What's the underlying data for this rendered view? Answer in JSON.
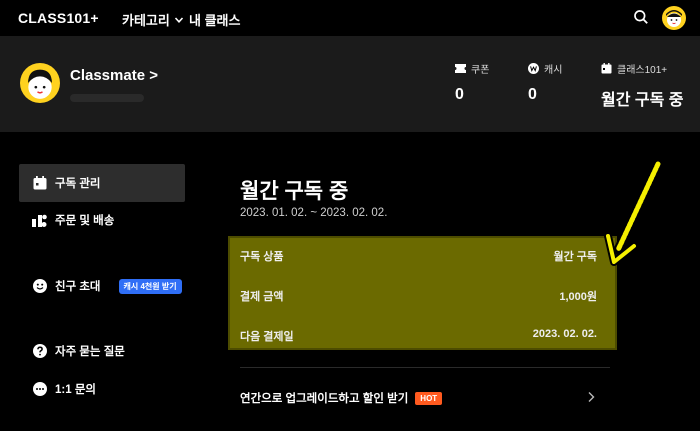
{
  "nav": {
    "logo": "CLASS101+",
    "category_label": "카테고리",
    "my_classes_label": "내 클래스"
  },
  "profile": {
    "name": "Classmate",
    "name_chevron": ">"
  },
  "stats": {
    "coupon_label": "쿠폰",
    "coupon_value": "0",
    "cash_label": "캐시",
    "cash_value": "0",
    "class_label": "클래스101+",
    "class_value": "월간 구독 중"
  },
  "sidebar": {
    "items": [
      {
        "label": "구독 관리"
      },
      {
        "label": "주문 및 배송"
      },
      {
        "label": "친구 초대",
        "badge": "캐시 4천원 받기"
      },
      {
        "label": "자주 묻는 질문"
      },
      {
        "label": "1:1 문의"
      }
    ]
  },
  "main": {
    "title": "월간 구독 중",
    "period": "2023. 01. 02. ~ 2023. 02. 02.",
    "details": [
      {
        "label": "구독 상품",
        "value": "월간 구독"
      },
      {
        "label": "결제 금액",
        "value": "1,000원"
      },
      {
        "label": "다음 결제일",
        "value": "2023. 02. 02."
      }
    ],
    "upgrade_label": "연간으로 업그레이드하고 할인 받기",
    "upgrade_badge": "HOT"
  },
  "colors": {
    "background": "#000000",
    "band": "#1b1b1b",
    "highlight": "#6b6a00",
    "accent_yellow": "#ffd21f",
    "badge_blue": "#2f6ef6",
    "hot_orange": "#ff5a1f"
  }
}
